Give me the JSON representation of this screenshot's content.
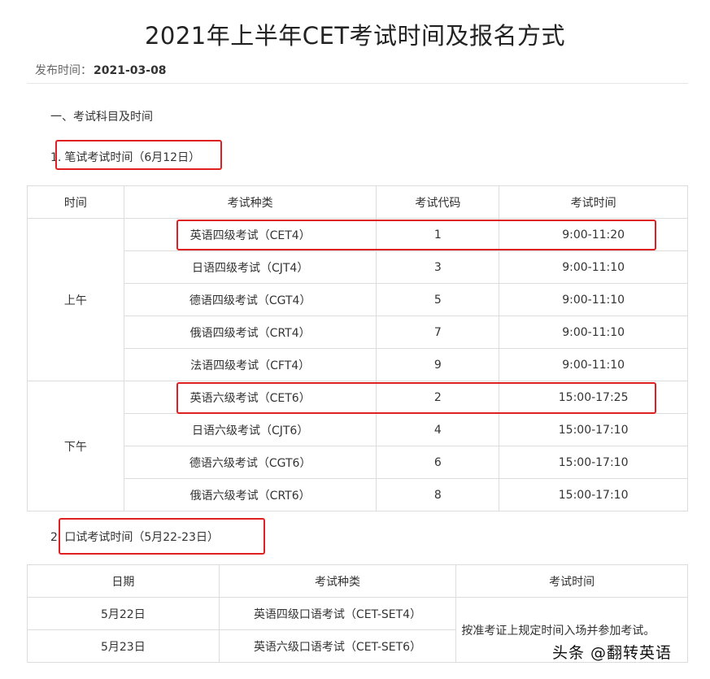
{
  "title": "2021年上半年CET考试时间及报名方式",
  "meta": {
    "label": "发布时间：",
    "date": "2021-03-08"
  },
  "section1": {
    "heading": "一、考试科目及时间"
  },
  "written": {
    "number": "1.",
    "heading": "笔试考试时间（6月12日）",
    "headers": [
      "时间",
      "考试种类",
      "考试代码",
      "考试时间"
    ],
    "groups": [
      {
        "period": "上午",
        "rows": [
          {
            "exam": "英语四级考试（CET4）",
            "code": "1",
            "time": "9:00-11:20"
          },
          {
            "exam": "日语四级考试（CJT4）",
            "code": "3",
            "time": "9:00-11:10"
          },
          {
            "exam": "德语四级考试（CGT4）",
            "code": "5",
            "time": "9:00-11:10"
          },
          {
            "exam": "俄语四级考试（CRT4）",
            "code": "7",
            "time": "9:00-11:10"
          },
          {
            "exam": "法语四级考试（CFT4）",
            "code": "9",
            "time": "9:00-11:10"
          }
        ]
      },
      {
        "period": "下午",
        "rows": [
          {
            "exam": "英语六级考试（CET6）",
            "code": "2",
            "time": "15:00-17:25"
          },
          {
            "exam": "日语六级考试（CJT6）",
            "code": "4",
            "time": "15:00-17:10"
          },
          {
            "exam": "德语六级考试（CGT6）",
            "code": "6",
            "time": "15:00-17:10"
          },
          {
            "exam": "俄语六级考试（CRT6）",
            "code": "8",
            "time": "15:00-17:10"
          }
        ]
      }
    ]
  },
  "oral": {
    "number": "2.",
    "heading": "口试考试时间（5月22-23日）",
    "headers": [
      "日期",
      "考试种类",
      "考试时间"
    ],
    "rows": [
      {
        "date": "5月22日",
        "exam": "英语四级口语考试（CET-SET4）"
      },
      {
        "date": "5月23日",
        "exam": "英语六级口语考试（CET-SET6）"
      }
    ],
    "time_note": "按准考证上规定时间入场并参加考试。"
  },
  "watermark": "头条 @翻转英语",
  "colors": {
    "highlight_box": "#e02020",
    "border": "#dcdcdc"
  }
}
